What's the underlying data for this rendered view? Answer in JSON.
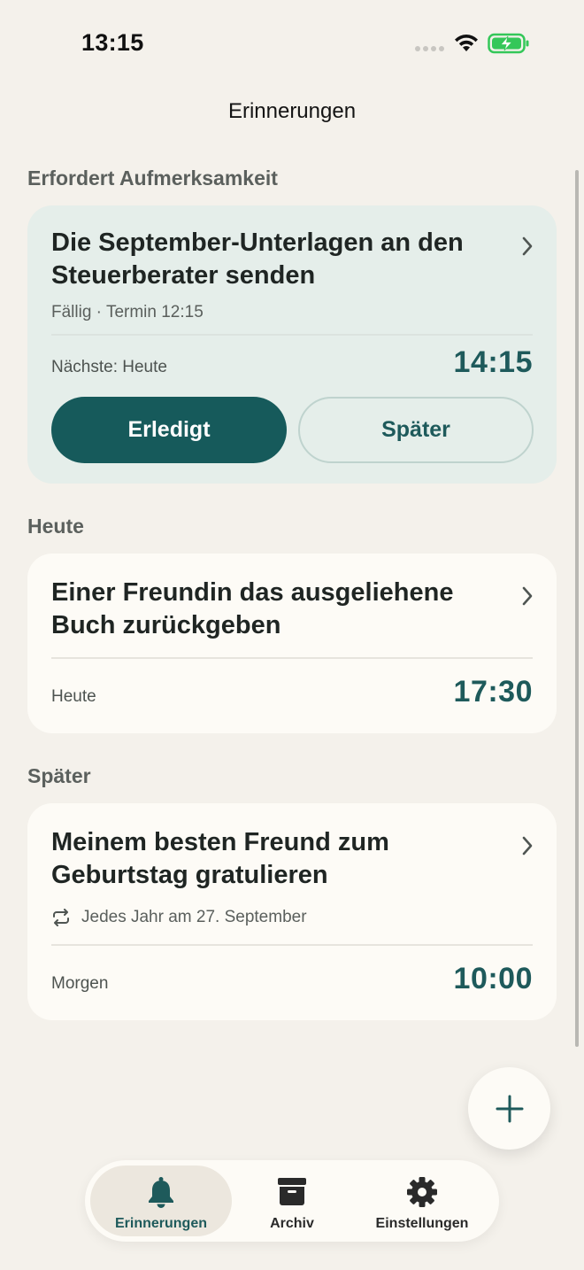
{
  "status_bar": {
    "time": "13:15",
    "battery_color": "#34C759"
  },
  "header": {
    "title": "Erinnerungen"
  },
  "sections": {
    "attention": {
      "label": "Erfordert Aufmerksamkeit",
      "card": {
        "title": "Die September-Unterlagen an den Steuerberater senden",
        "subtitle": "Fällig · Termin 12:15",
        "when": "Nächste: Heute",
        "time": "14:15",
        "done_label": "Erledigt",
        "later_label": "Später"
      }
    },
    "today": {
      "label": "Heute",
      "card": {
        "title": "Einer Freundin das ausgeliehene Buch zurückgeben",
        "when": "Heute",
        "time": "17:30"
      }
    },
    "later": {
      "label": "Später",
      "card": {
        "title": "Meinem besten Freund zum Geburtstag gratulieren",
        "repeat": "Jedes Jahr am 27. September",
        "when": "Morgen",
        "time": "10:00"
      }
    }
  },
  "fab": {
    "icon": "plus-icon"
  },
  "tabs": [
    {
      "label": "Erinnerungen",
      "icon": "bell-icon",
      "active": true
    },
    {
      "label": "Archiv",
      "icon": "archive-box-icon",
      "active": false
    },
    {
      "label": "Einstellungen",
      "icon": "gear-icon",
      "active": false
    }
  ],
  "colors": {
    "accent": "#165A5B",
    "background": "#F4F1EB",
    "card": "#FDFBF6",
    "attention_card": "#E5EEEA"
  }
}
